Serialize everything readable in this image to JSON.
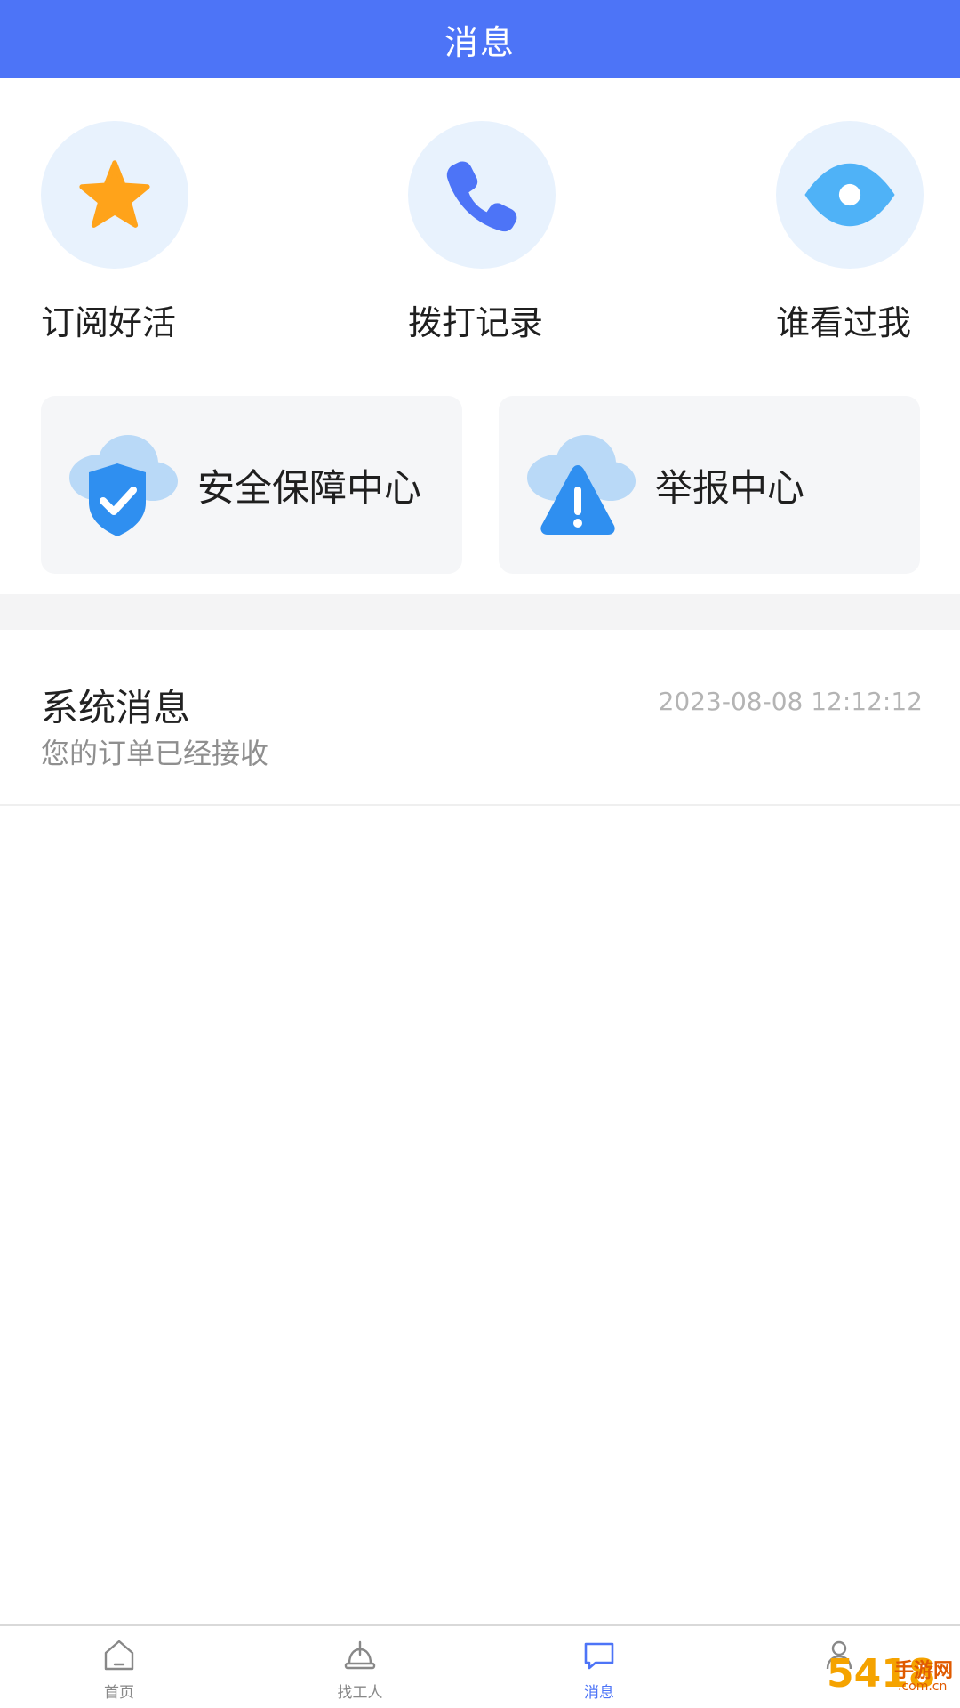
{
  "header": {
    "title": "消息"
  },
  "quick_actions": [
    {
      "label": "订阅好活",
      "icon": "star-icon"
    },
    {
      "label": "拨打记录",
      "icon": "phone-icon"
    },
    {
      "label": "谁看过我",
      "icon": "eye-icon"
    }
  ],
  "cards": [
    {
      "label": "安全保障中心",
      "icon": "shield-check-icon"
    },
    {
      "label": "举报中心",
      "icon": "warning-icon"
    }
  ],
  "messages": [
    {
      "title": "系统消息",
      "time": "2023-08-08 12:12:12",
      "summary": "您的订单已经接收"
    }
  ],
  "tabbar": {
    "items": [
      {
        "label": "首页",
        "icon": "home-icon",
        "active": false
      },
      {
        "label": "找工人",
        "icon": "worker-helmet-icon",
        "active": false
      },
      {
        "label": "消息",
        "icon": "message-icon",
        "active": true
      },
      {
        "label": "",
        "icon": "user-icon",
        "active": false
      }
    ]
  },
  "watermark": {
    "number": "5418",
    "text": "手游网",
    "sub": ".com.cn"
  },
  "colors": {
    "primary": "#4d74f7",
    "icon_bg": "#e8f2fd",
    "star": "#ffa31a",
    "phone": "#4d74f7",
    "eye": "#4fb2f7",
    "card_bg": "#f5f6f8",
    "cloud": "#b9d9f7",
    "shield": "#2f8ff0"
  }
}
